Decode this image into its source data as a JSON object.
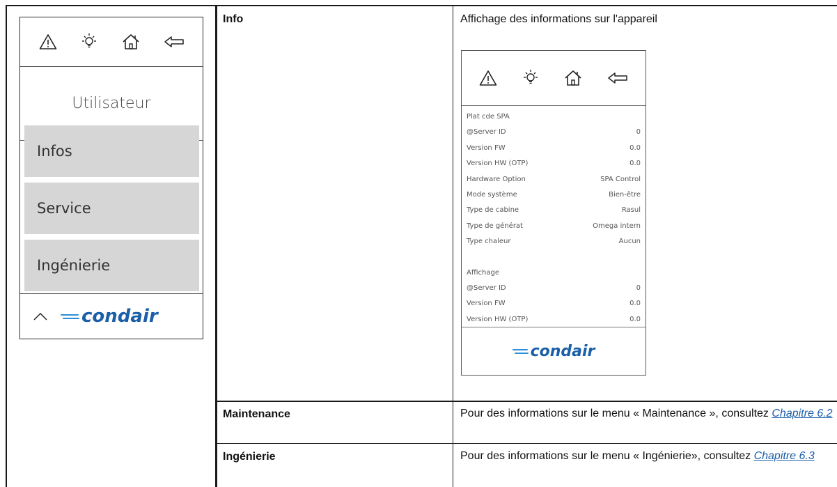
{
  "device": {
    "heading": "Utilisateur",
    "menu": [
      "Infos",
      "Service",
      "Ingénierie"
    ],
    "logo_text": "condair"
  },
  "table": {
    "rows": [
      {
        "label": "Info",
        "description": "Affichage des informations sur l'appareil"
      },
      {
        "label": "Maintenance",
        "text_before": "Pour des informations sur le menu « Maintenance », consultez ",
        "link": "Chapitre 6.2"
      },
      {
        "label": "Ingénierie",
        "text_before": "Pour des informations sur le menu « Ingénierie», consultez ",
        "link": "Chapitre 6.3"
      }
    ]
  },
  "info_screen": {
    "sections": [
      {
        "rows": [
          {
            "label": "Plat cde SPA",
            "value": ""
          },
          {
            "label": "@Server ID",
            "value": "0"
          },
          {
            "label": "Version FW",
            "value": "0.0"
          },
          {
            "label": "Version HW (OTP)",
            "value": "0.0"
          },
          {
            "label": "Hardware Option",
            "value": "SPA Control"
          },
          {
            "label": "Mode système",
            "value": "Bien-être"
          },
          {
            "label": "Type de cabine",
            "value": "Rasul"
          },
          {
            "label": "Type de générat",
            "value": "Omega intern"
          },
          {
            "label": "Type chaleur",
            "value": "Aucun"
          }
        ]
      },
      {
        "rows": [
          {
            "label": "Affichage",
            "value": ""
          },
          {
            "label": "@Server ID",
            "value": "0"
          },
          {
            "label": "Version FW",
            "value": "0.0"
          },
          {
            "label": "Version HW (OTP)",
            "value": "0.0"
          }
        ]
      }
    ],
    "logo_text": "condair"
  },
  "icons": [
    "warning-icon",
    "lightbulb-icon",
    "home-icon",
    "back-arrow-icon",
    "chevron-up-icon"
  ],
  "colors": {
    "brand": "#1b5fa8",
    "brand_wave": "#2d8fd5",
    "menu_bg": "#d6d6d6"
  }
}
